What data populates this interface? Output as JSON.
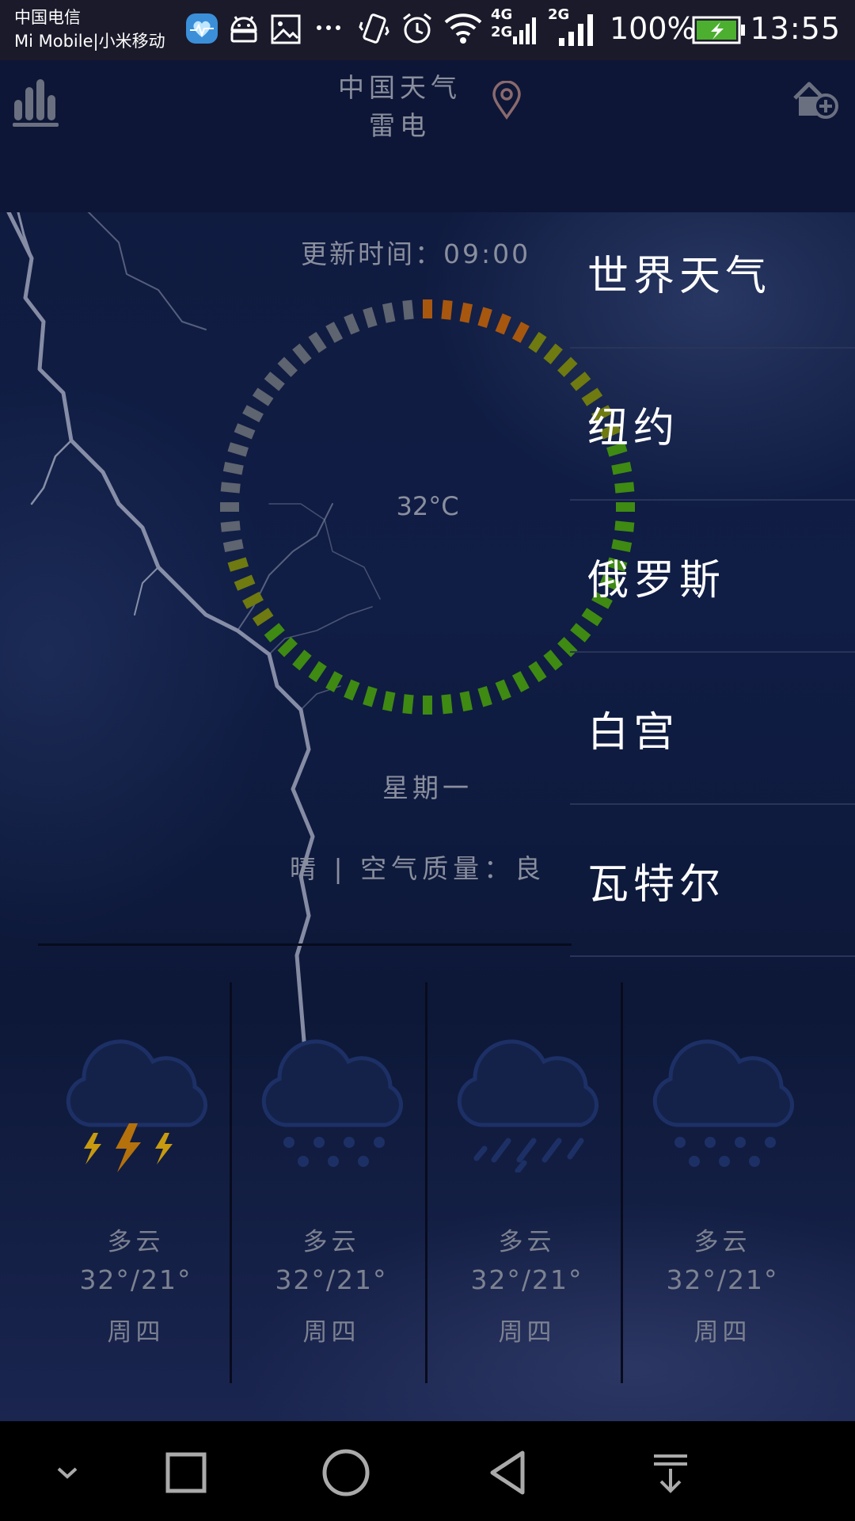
{
  "status_bar": {
    "carrier_line1": "中国电信",
    "carrier_line2": "Mi Mobile|小米移动",
    "network1": "4G",
    "network1_sub": "2G",
    "network2": "2G",
    "battery_percent": "100%",
    "time": "13:55",
    "icons": [
      "heart-app-icon",
      "android-icon",
      "image-icon",
      "more-icon",
      "vibrate-icon",
      "alarm-icon",
      "wifi-icon",
      "signal-icon",
      "signal-icon",
      "battery-icon"
    ]
  },
  "header": {
    "title": "中国天气",
    "subtitle": "雷电",
    "left_icon": "bar-chart-icon",
    "location_icon": "location-pin-icon",
    "right_icon": "add-home-icon"
  },
  "main": {
    "update_time": "更新时间：09:00",
    "temperature": "32°C",
    "weekday": "星期一",
    "condition_line": "晴 | 空气质量：良"
  },
  "drawer": {
    "items": [
      {
        "label": "世界天气"
      },
      {
        "label": "纽约"
      },
      {
        "label": "俄罗斯"
      },
      {
        "label": "白宫"
      },
      {
        "label": "瓦特尔"
      }
    ]
  },
  "forecast": [
    {
      "icon": "thunderstorm-icon",
      "desc": "多云",
      "temp": "32°/21°",
      "day": "周四"
    },
    {
      "icon": "snow-cloud-icon",
      "desc": "多云",
      "temp": "32°/21°",
      "day": "周四"
    },
    {
      "icon": "rain-cloud-icon",
      "desc": "多云",
      "temp": "32°/21°",
      "day": "周四"
    },
    {
      "icon": "snow-cloud-icon",
      "desc": "多云",
      "temp": "32°/21°",
      "day": "周四"
    }
  ],
  "nav_bar": [
    "chevron-down-icon",
    "square-icon",
    "circle-icon",
    "back-triangle-icon",
    "pull-down-icon"
  ],
  "colors": {
    "background": "#0f1a3d",
    "ring_orange": "#a8570f",
    "ring_olive": "#6f7a10",
    "ring_green": "#3f8a12",
    "ring_gray": "#5e6470",
    "text_muted": "#8a8f9e",
    "drawer_text": "#ffffff"
  }
}
